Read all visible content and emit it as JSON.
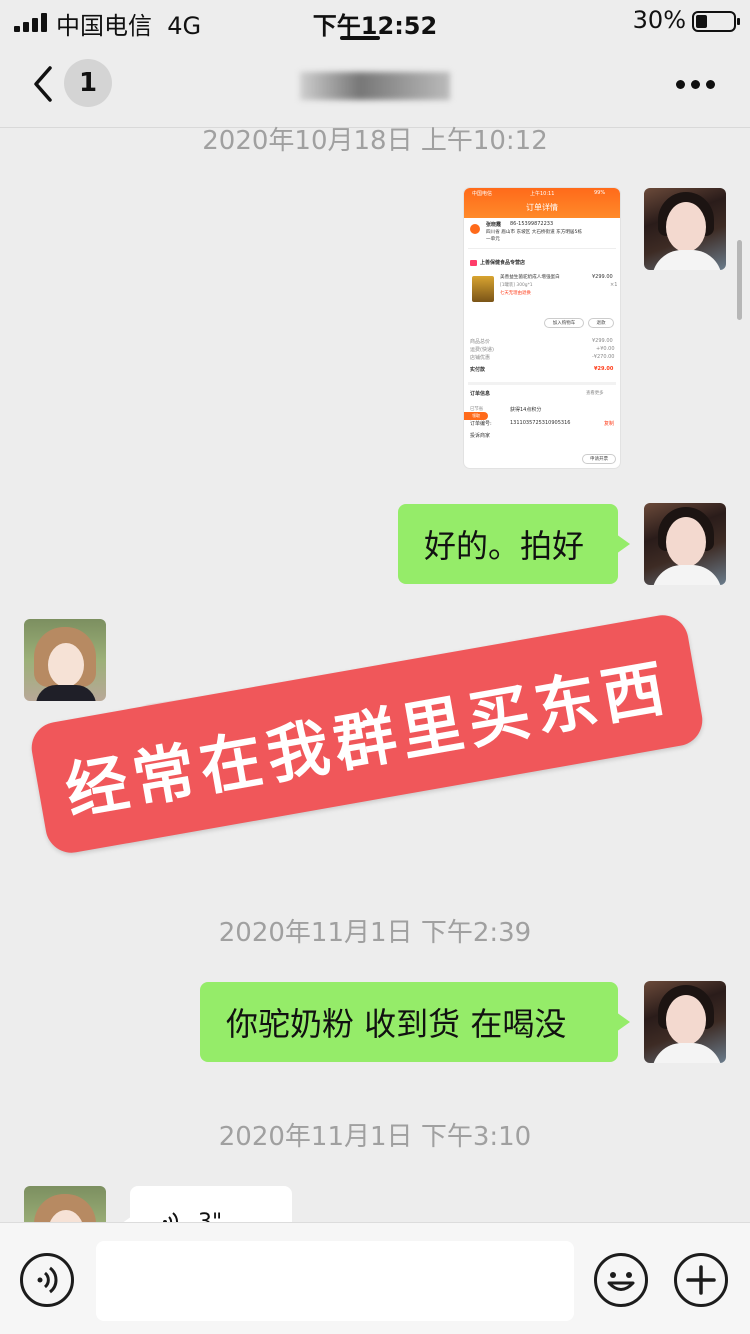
{
  "status_bar": {
    "carrier": "中国电信",
    "network": "4G",
    "time": "下午12:52",
    "battery_percent": "30%",
    "battery_level": 0.3
  },
  "nav": {
    "back_icon": "chevron-left-icon",
    "unread_count": "1",
    "title": "",
    "more_icon": "more-dots-icon"
  },
  "messages": {
    "ts1": "2020年10月18日 上午10:12",
    "shot": {
      "carrier": "中国电信",
      "time": "上午10:11",
      "battery": "99%",
      "title": "订单详情",
      "receiver": "张晓霞",
      "phone": "86-15399872233",
      "address_line1": "四川省 眉山市 东坡区 大石桥街道 东方明居5栋",
      "address_line2": "一单元",
      "store": "上善保健食品专营店",
      "product": "美善益生菌驼奶成人增强蛋白",
      "spec": "[1罐装] 300g*1",
      "price": "¥299.00",
      "qty": "×1",
      "promo": "七天无理由退换",
      "btn_cart": "加入购物车",
      "btn_refund": "退款",
      "total_label": "商品总价",
      "total_value": "¥299.00",
      "shipping_label": "运费(快递)",
      "shipping_value": "+¥0.00",
      "discount_label": "店铺优惠",
      "discount_value": "-¥270.00",
      "paid_label": "实付款",
      "paid_value": "¥29.00",
      "info_title": "订单信息",
      "info_more": "查看更多",
      "save_label": "已节省",
      "save_value": "获得14点积分",
      "order_label": "订单编号:",
      "order_no": "1311035725310905316",
      "copy": "复制",
      "tag": "领取",
      "complaint": "投诉商家",
      "invoice_btn": "申请开票"
    },
    "bubble1": "好的。拍好",
    "overlay": "经常在我群里买东西",
    "ts2": "2020年11月1日 下午2:39",
    "bubble2": "你驼奶粉 收到货 在喝没",
    "ts3": "2020年11月1日 下午3:10",
    "voice_duration": "3\""
  },
  "input_bar": {
    "voice_icon": "voice-toggle-icon",
    "input_value": "",
    "emoji_icon": "emoji-icon",
    "plus_icon": "plus-icon"
  },
  "colors": {
    "bubble_green": "#95ec69",
    "banner_red": "#f0575a",
    "app_bg": "#ededed",
    "accent_orange": "#ff6a1a"
  }
}
